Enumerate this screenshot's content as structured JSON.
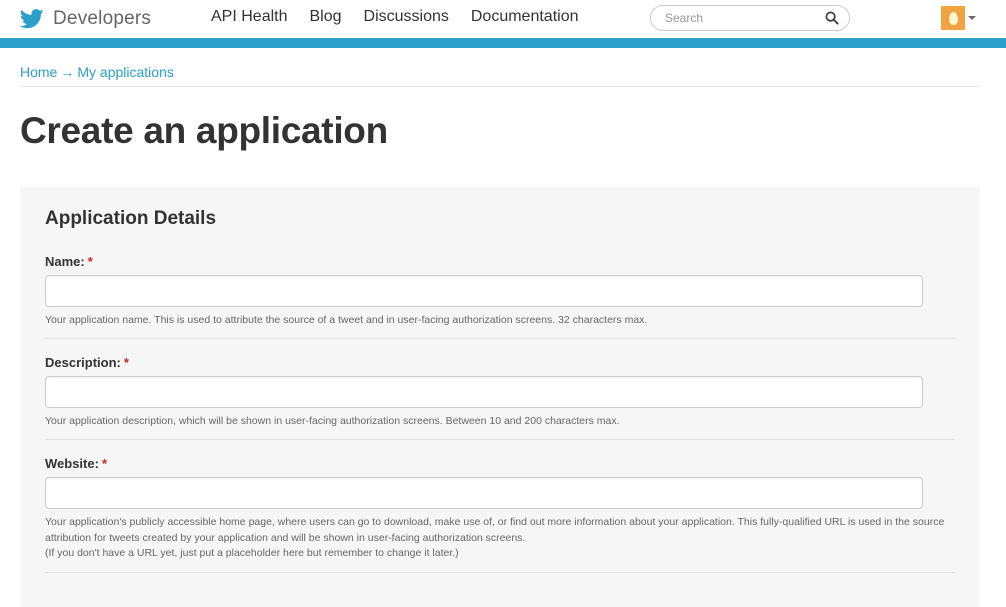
{
  "header": {
    "brand": "Developers",
    "nav": [
      "API Health",
      "Blog",
      "Discussions",
      "Documentation"
    ],
    "search_placeholder": "Search"
  },
  "breadcrumb": {
    "home": "Home",
    "separator": "→",
    "current": "My applications"
  },
  "page_title": "Create an application",
  "panel": {
    "title": "Application Details",
    "required_marker": "*",
    "fields": [
      {
        "label": "Name:",
        "value": "",
        "hint": "Your application name. This is used to attribute the source of a tweet and in user-facing authorization screens. 32 characters max."
      },
      {
        "label": "Description:",
        "value": "",
        "hint": "Your application description, which will be shown in user-facing authorization screens. Between 10 and 200 characters max."
      },
      {
        "label": "Website:",
        "value": "",
        "hint": "Your application's publicly accessible home page, where users can go to download, make use of, or find out more information about your application. This fully-qualified URL is used in the source attribution for tweets created by your application and will be shown in user-facing authorization screens.",
        "hint2": "(If you don't have a URL yet, just put a placeholder here but remember to change it later.)"
      }
    ]
  },
  "colors": {
    "accent": "#2b9fca",
    "required": "#cc2222",
    "panel_bg": "#f6f6f6",
    "avatar": "#f0a340"
  },
  "icons": [
    "twitter-bird-icon",
    "search-icon",
    "egg-avatar-icon",
    "caret-down-icon"
  ]
}
